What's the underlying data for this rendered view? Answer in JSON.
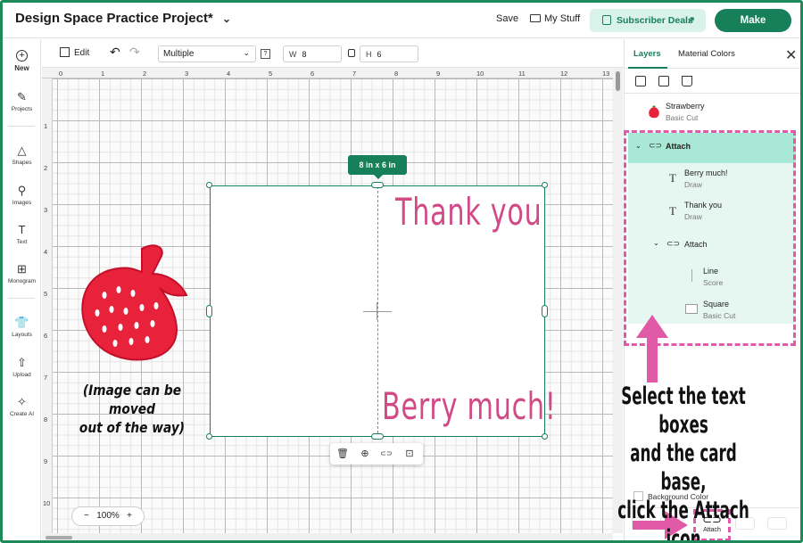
{
  "header": {
    "project_title": "Design Space Practice Project*",
    "title_chevron": "⌄",
    "save_label": "Save",
    "mystuff_label": "My Stuff",
    "subscriber_label": "Subscriber Deals",
    "subscriber_arrow": "↗",
    "make_label": "Make"
  },
  "sidebar": {
    "items": [
      {
        "label": "New",
        "icon": "+"
      },
      {
        "label": "Projects",
        "icon": "✎"
      },
      {
        "label": "Shapes",
        "icon": "△"
      },
      {
        "label": "Images",
        "icon": "⚲"
      },
      {
        "label": "Text",
        "icon": "T"
      },
      {
        "label": "Monogram",
        "icon": "⊞"
      },
      {
        "label": "Layouts",
        "icon": "👕"
      },
      {
        "label": "Upload",
        "icon": "⇧"
      },
      {
        "label": "Create AI",
        "icon": "✧"
      }
    ]
  },
  "toolbar": {
    "edit_label": "Edit",
    "undo_icon": "↶",
    "redo_icon": "↷",
    "operation_value": "Multiple",
    "dropdown_icon": "⌄",
    "help_icon": "?",
    "w_label": "W",
    "w_value": "8",
    "h_label": "H",
    "h_value": "6"
  },
  "ruler": {
    "top": [
      "0",
      "1",
      "2",
      "3",
      "4",
      "5",
      "6",
      "7",
      "8",
      "9",
      "10",
      "11",
      "12",
      "13"
    ],
    "left": [
      "1",
      "2",
      "3",
      "4",
      "5",
      "6",
      "7",
      "8",
      "9",
      "10"
    ]
  },
  "canvas": {
    "size_pill": "8 in x 6 in",
    "text_top": "Thank you",
    "text_bottom": "Berry much!",
    "strawberry_note_line1": "(Image can be moved",
    "strawberry_note_line2": "out of the way)",
    "zoom_minus": "−",
    "zoom_value": "100%",
    "zoom_plus": "+",
    "context_icons": [
      "🗑",
      "⊕",
      "⊂⊃",
      "⊡"
    ]
  },
  "panel": {
    "tab_layers": "Layers",
    "tab_material": "Material Colors",
    "close_icon": "✕",
    "layers": [
      {
        "name": "Strawberry",
        "op": "Basic Cut"
      },
      {
        "name": "Attach",
        "op": ""
      },
      {
        "name": "Berry much!",
        "op": "Draw"
      },
      {
        "name": "Thank you",
        "op": "Draw"
      },
      {
        "name": "Attach",
        "op": ""
      },
      {
        "name": "Line",
        "op": "Score"
      },
      {
        "name": "Square",
        "op": "Basic Cut"
      }
    ],
    "instruction_line1": "Select the text boxes",
    "instruction_line2": "and the card base,",
    "instruction_line3": "click the Attach icon",
    "background_color_label": "Background Color",
    "attach_button_label": "Attach",
    "accent_pink": "#e05aa8",
    "accent_green": "#17805a"
  }
}
